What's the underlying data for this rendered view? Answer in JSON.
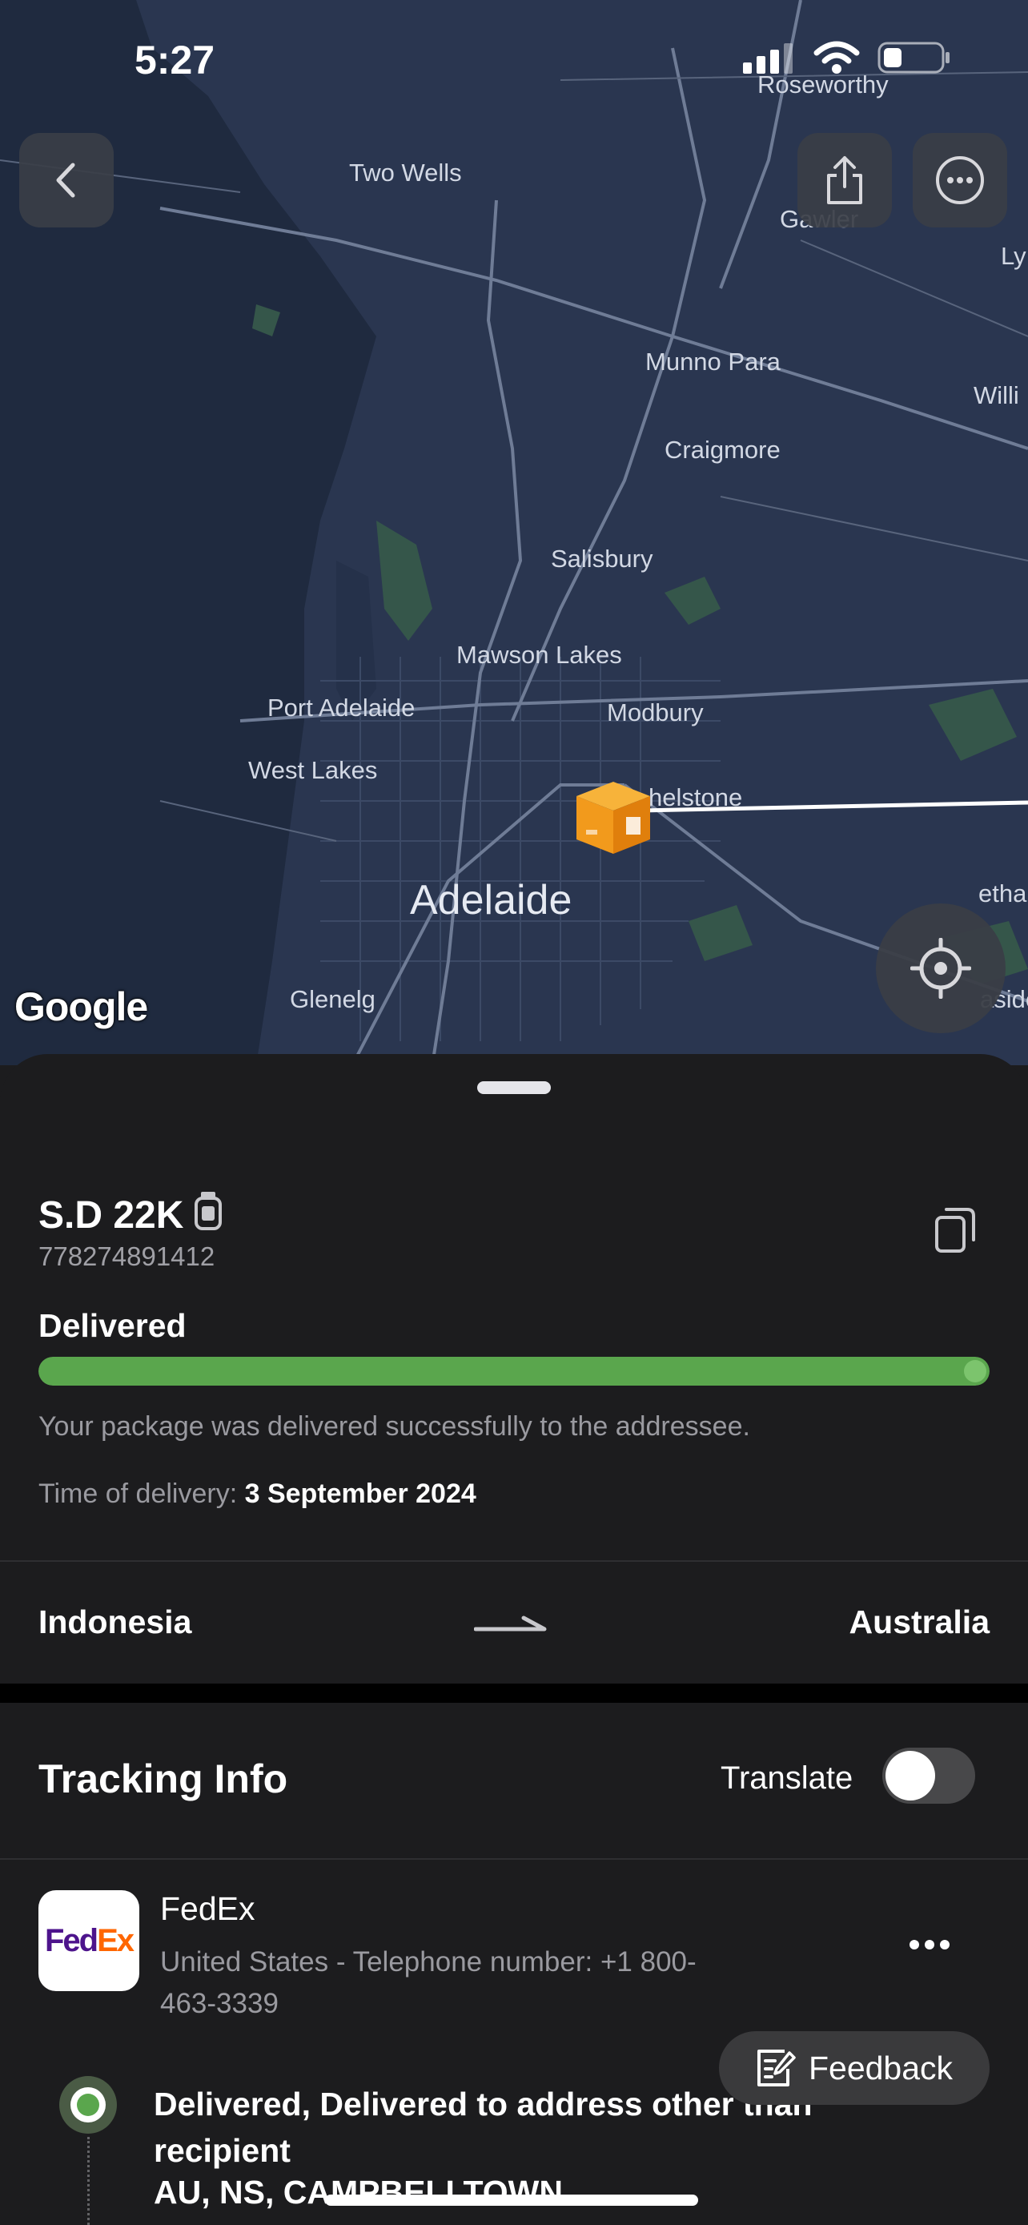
{
  "status_bar": {
    "time": "5:27"
  },
  "map": {
    "labels": {
      "roseworthy": "Roseworthy",
      "two_wells": "Two Wells",
      "gawler": "Gawler",
      "ly": "Ly",
      "munno_para": "Munno Para",
      "willi": "Willi",
      "craigmore": "Craigmore",
      "salisbury": "Salisbury",
      "mawson_lakes": "Mawson Lakes",
      "port_adelaide": "Port Adelaide",
      "modbury": "Modbury",
      "west_lakes": "West Lakes",
      "athelstone": "helstone",
      "adelaide": "Adelaide",
      "stirling": "etha",
      "glenelg": "Glenelg",
      "aside": "aside"
    },
    "attribution": "Google",
    "controls": [
      "back-icon",
      "share-icon",
      "more-icon",
      "locate-icon"
    ]
  },
  "package": {
    "name": "S.D 22K",
    "number": "778274891412",
    "status": "Delivered",
    "progress": 1.0,
    "description": "Your package was delivered successfully to the addressee.",
    "delivery_time_label": "Time of delivery:",
    "delivery_time_value": "3 September 2024"
  },
  "route": {
    "from": "Indonesia",
    "to": "Australia"
  },
  "tracking": {
    "header": "Tracking Info",
    "translate_label": "Translate",
    "translate_on": false
  },
  "carrier": {
    "logo_text_fed": "Fed",
    "logo_text_ex": "Ex",
    "name": "FedEx",
    "info": "United States - Telephone number: +1 800-463-3339"
  },
  "events": [
    {
      "title": "Delivered, Delivered to address other than recipient",
      "location": "AU, NS, CAMPBELLTOWN"
    }
  ],
  "feedback": {
    "label": "Feedback"
  },
  "colors": {
    "accent_green": "#5aa64d",
    "sheet_bg": "#1c1c1e",
    "map_bg": "#2a3650"
  }
}
